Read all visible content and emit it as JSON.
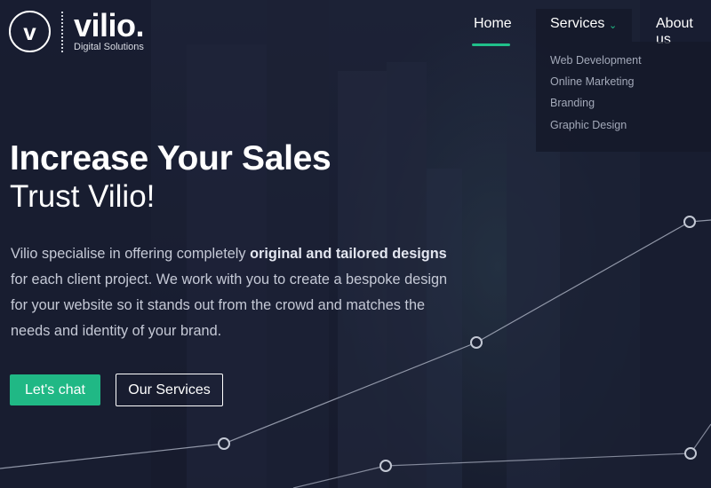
{
  "brand": {
    "logo_letter": "v",
    "name": "vilio.",
    "tagline": "Digital Solutions"
  },
  "nav": {
    "items": [
      {
        "label": "Home",
        "active": true
      },
      {
        "label": "Services",
        "active": false,
        "has_dropdown": true
      },
      {
        "label": "About us",
        "active": false
      }
    ],
    "services_menu": [
      "Web Development",
      "Online Marketing",
      "Branding",
      "Graphic Design"
    ]
  },
  "hero": {
    "title": "Increase Your Sales",
    "subtitle": "Trust Vilio!",
    "para_before": "Vilio specialise in offering completely ",
    "para_bold": "original and tailored designs",
    "para_after": " for each client project. We work with you to create a bespoke design for your website so it stands out from the crowd and matches the needs and identity of your brand.",
    "primary_button": "Let's chat",
    "secondary_button": "Our Services"
  },
  "colors": {
    "accent": "#20b885",
    "background": "#1c2235",
    "dropdown_bg": "#141828",
    "muted_text": "#a3a9b9"
  },
  "icons": {
    "dropdown_chevron": "chevron-down-icon"
  }
}
